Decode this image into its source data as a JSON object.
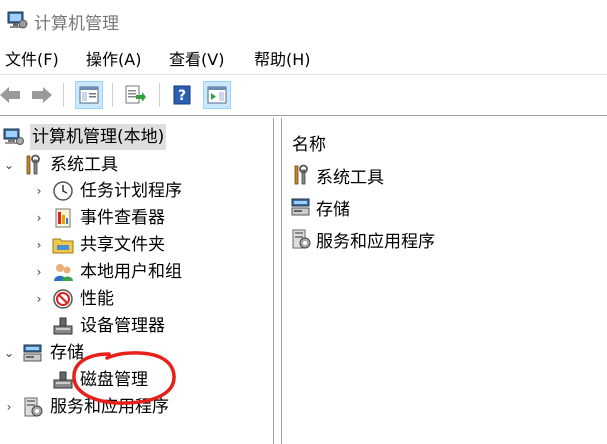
{
  "window": {
    "title": "计算机管理"
  },
  "menubar": {
    "items": [
      "文件(F)",
      "操作(A)",
      "查看(V)",
      "帮助(H)"
    ]
  },
  "toolbar": {
    "buttons": [
      "back-arrow-icon",
      "forward-arrow-icon",
      "show-hide-console-tree-icon",
      "export-list-icon",
      "help-icon",
      "show-action-pane-icon"
    ]
  },
  "tree": {
    "root": "计算机管理(本地)",
    "system_tools": "系统工具",
    "task_scheduler": "任务计划程序",
    "event_viewer": "事件查看器",
    "shared_folders": "共享文件夹",
    "local_users": "本地用户和组",
    "performance": "性能",
    "device_manager": "设备管理器",
    "storage": "存储",
    "disk_management": "磁盘管理",
    "services_apps": "服务和应用程序"
  },
  "right_pane": {
    "header": "名称",
    "items": [
      "系统工具",
      "存储",
      "服务和应用程序"
    ]
  },
  "colors": {
    "annotation_circle": "#e8201a",
    "selection": "#cce8ff"
  }
}
